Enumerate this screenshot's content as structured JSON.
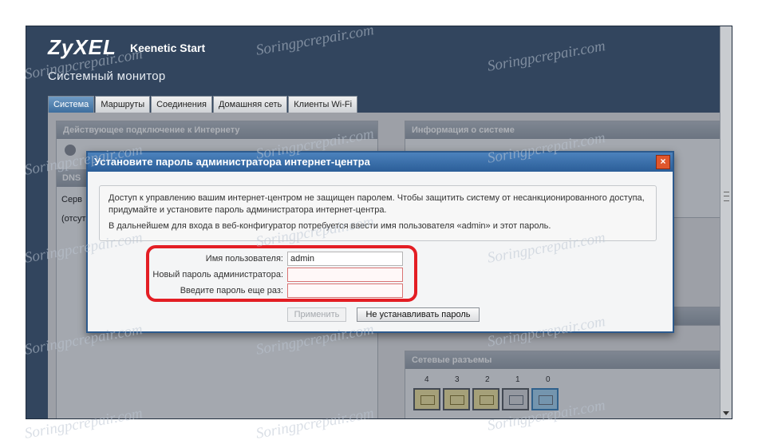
{
  "app": {
    "brand": "ZyXEL",
    "product": "Keenetic Start",
    "page_title": "Системный монитор"
  },
  "tabs": [
    {
      "label": "Система",
      "active": true
    },
    {
      "label": "Маршруты",
      "active": false
    },
    {
      "label": "Соединения",
      "active": false
    },
    {
      "label": "Домашняя сеть",
      "active": false
    },
    {
      "label": "Клиенты Wi-Fi",
      "active": false
    }
  ],
  "panels": {
    "internet_head": "Действующее подключение к Интернету",
    "dns_label": "DNS",
    "server_label": "Серв",
    "absent_label": "(отсут",
    "system_info_head": "Информация о системе",
    "network_ports_head": "Сетевые разъемы",
    "port_numbers": [
      "4",
      "3",
      "2",
      "1",
      "0"
    ]
  },
  "dialog": {
    "title": "Установите пароль администратора интернет-центра",
    "close_symbol": "×",
    "notice_line1": "Доступ к управлению вашим интернет-центром не защищен паролем. Чтобы защитить систему от несанкционированного доступа, придумайте и установите пароль администратора интернет-центра.",
    "notice_line2": "В дальнейшем для входа в веб-конфигуратор потребуется ввести имя пользователя «admin» и этот пароль.",
    "username_label": "Имя пользователя:",
    "username_value": "admin",
    "new_password_label": "Новый пароль администратора:",
    "new_password_value": "",
    "repeat_password_label": "Введите пароль еще раз:",
    "repeat_password_value": "",
    "apply_button": "Применить",
    "skip_button": "Не устанавливать пароль"
  },
  "watermark": "Soringpcrepair.com",
  "colors": {
    "chrome": "#32455e",
    "dialog_header": "#2b5e98",
    "highlight": "#e31e24",
    "active_tab": "#3d6e9e"
  }
}
